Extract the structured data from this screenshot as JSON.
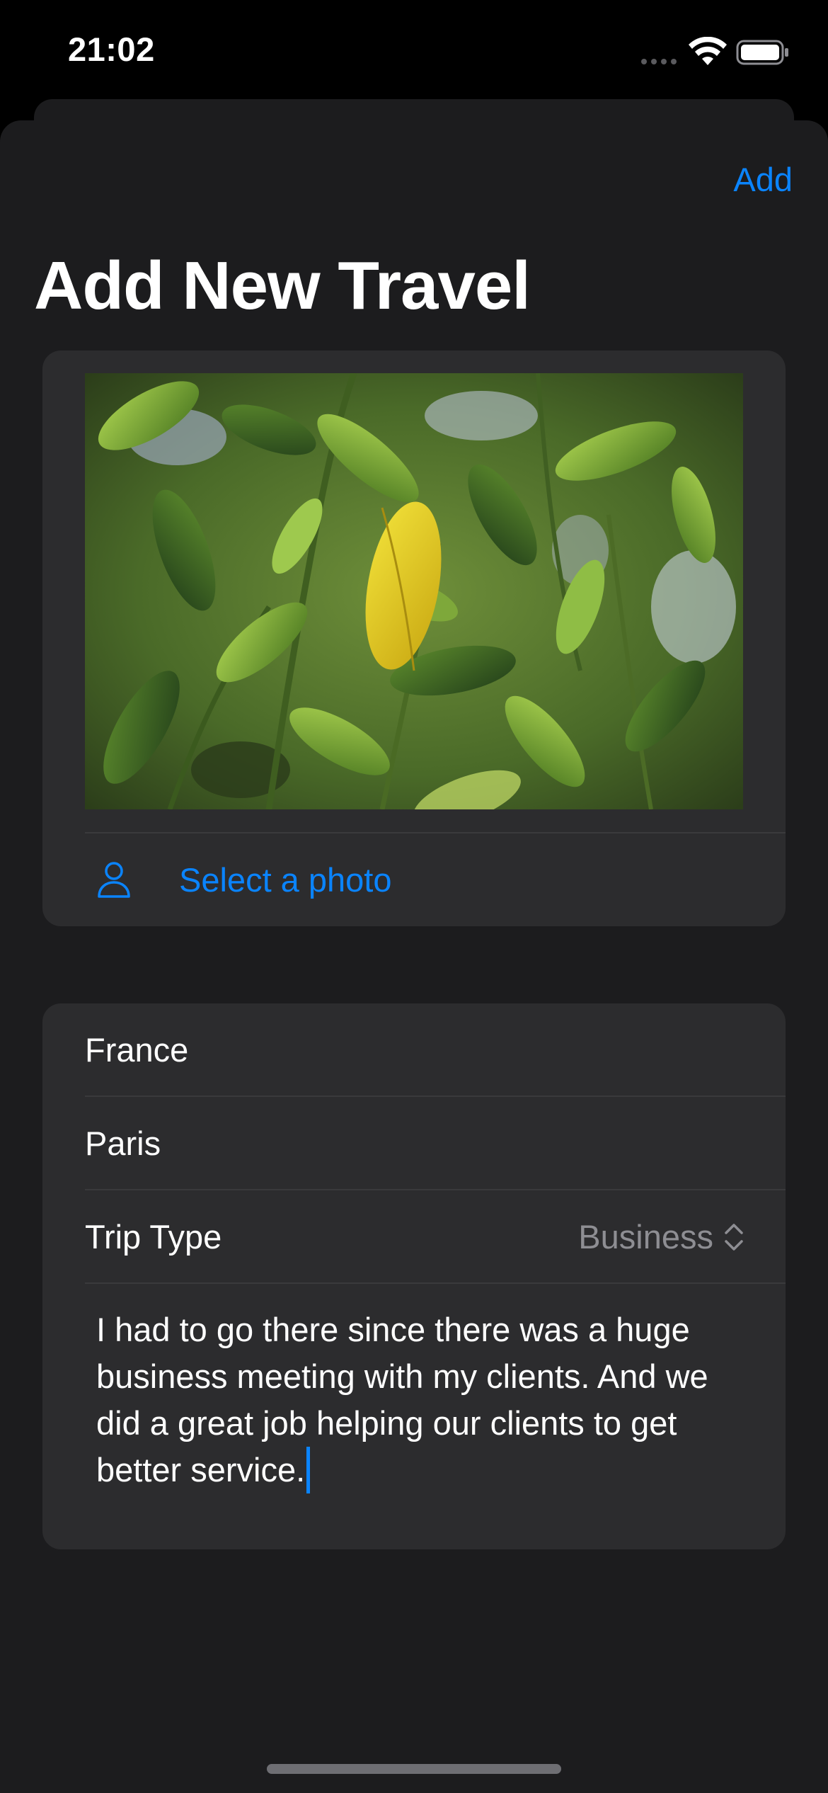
{
  "status_bar": {
    "time": "21:02"
  },
  "nav": {
    "add_label": "Add",
    "title": "Add New Travel"
  },
  "photo": {
    "select_label": "Select a photo",
    "icon": "person-icon"
  },
  "form": {
    "country": "France",
    "city": "Paris",
    "trip_type_label": "Trip Type",
    "trip_type_value": "Business",
    "notes": "I had to go there since there was a huge business meeting with my clients. And we did a great job helping our clients to get better service."
  },
  "colors": {
    "accent": "#0a84ff",
    "sheet_background": "#1c1c1e",
    "section_background": "#2c2c2e",
    "secondary_text": "#8e8e93"
  }
}
